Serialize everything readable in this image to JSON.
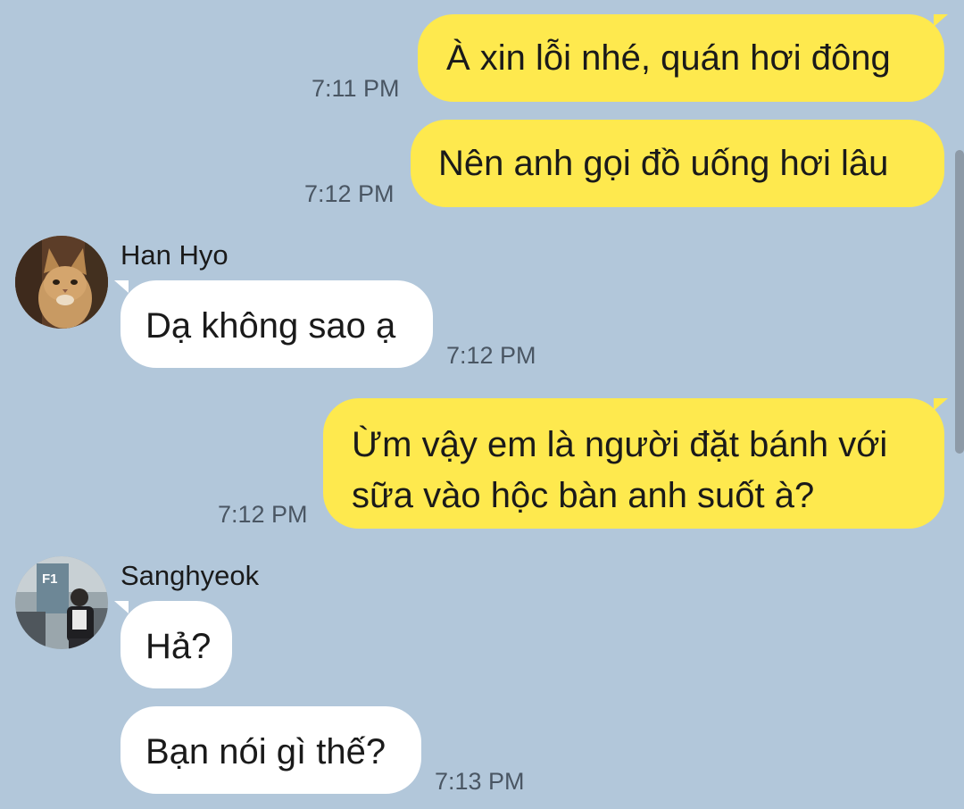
{
  "messages": [
    {
      "text": "À xin lỗi nhé, quán hơi đông",
      "time": "7:11 PM"
    },
    {
      "text": "Nên anh gọi đồ uống hơi lâu",
      "time": "7:12 PM"
    },
    {
      "sender": "Han Hyo",
      "text": "Dạ không sao ạ",
      "time": "7:12 PM"
    },
    {
      "text_line1": "Ừm vậy em là người đặt bánh với",
      "text_line2": "sữa vào hộc bàn anh suốt à?",
      "time": "7:12 PM"
    },
    {
      "sender": "Sanghyeok",
      "text": "Hả?"
    },
    {
      "text": "Bạn nói gì thế?",
      "time": "7:13 PM"
    }
  ],
  "avatars": {
    "han_hyo": {
      "icon": "cat-avatar-icon"
    },
    "sanghyeok": {
      "icon": "person-avatar-icon",
      "sign_text": "F1"
    }
  },
  "colors": {
    "background": "#b2c7da",
    "outgoing_bubble": "#fee94e",
    "incoming_bubble": "#ffffff"
  }
}
